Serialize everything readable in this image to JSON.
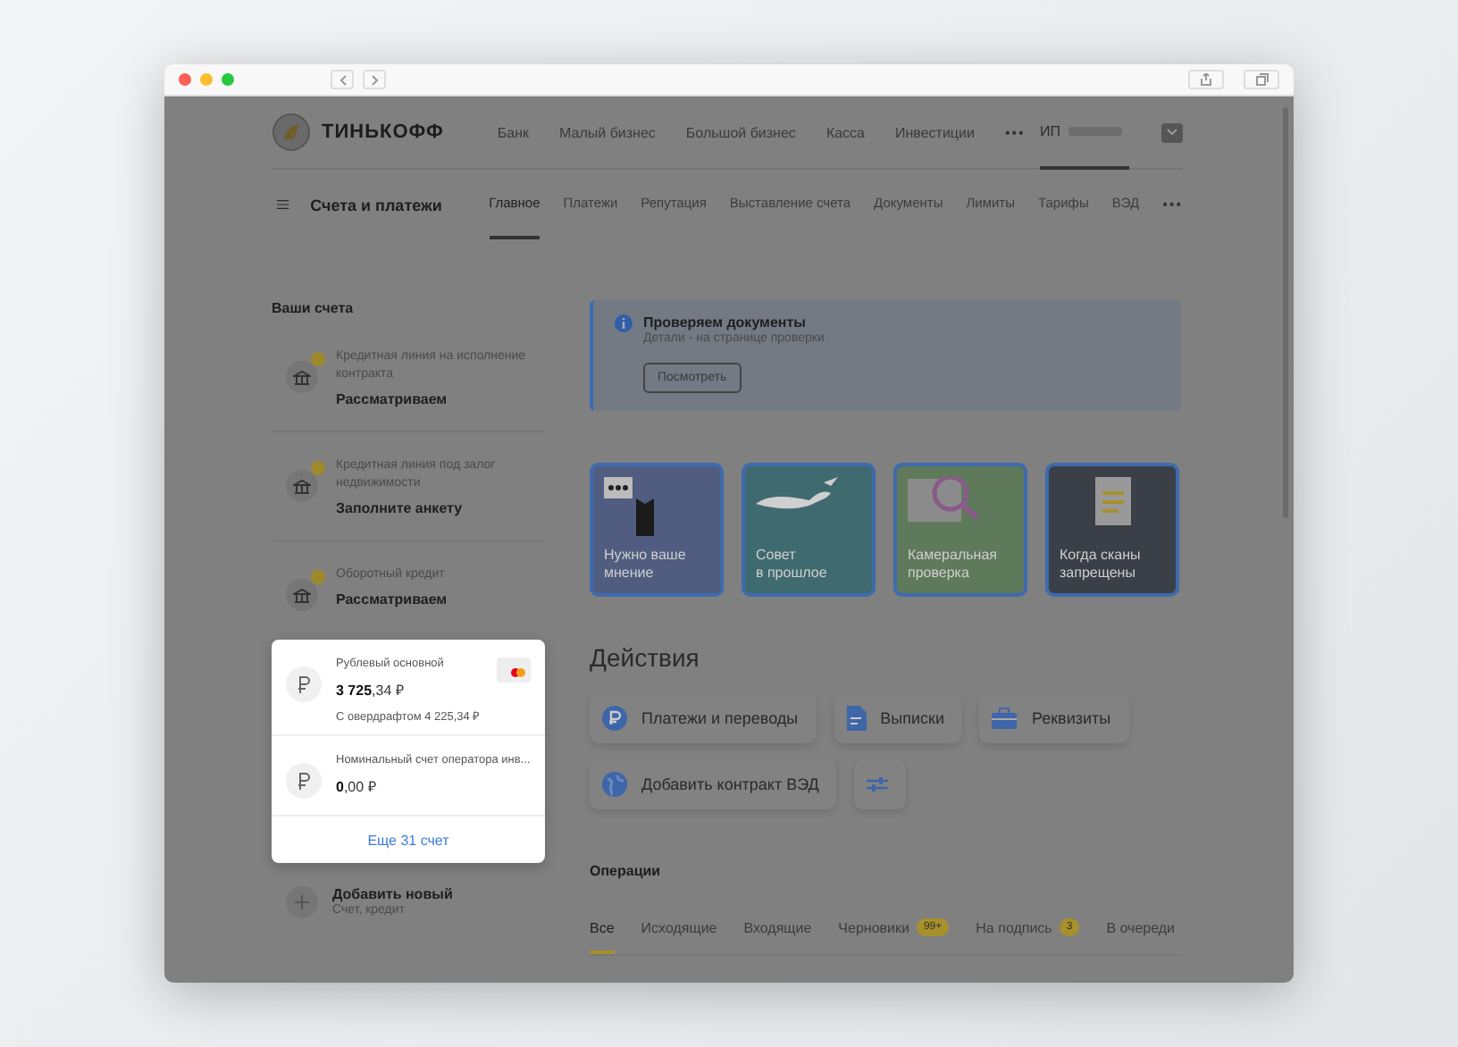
{
  "header": {
    "logo": "ТИНЬКОФФ",
    "nav": [
      "Банк",
      "Малый бизнес",
      "Большой бизнес",
      "Касса",
      "Инвестиции"
    ],
    "more": "•••",
    "account": "ИП"
  },
  "subnav": {
    "title": "Счета и платежи",
    "tabs": [
      {
        "label": "Главное",
        "selected": true
      },
      {
        "label": "Платежи",
        "selected": false
      },
      {
        "label": "Репутация",
        "selected": false
      },
      {
        "label": "Выставление счета",
        "selected": false
      },
      {
        "label": "Документы",
        "selected": false
      },
      {
        "label": "Лимиты",
        "selected": false
      },
      {
        "label": "Тарифы",
        "selected": false
      },
      {
        "label": "ВЭД",
        "selected": false
      }
    ],
    "more": "•••"
  },
  "accounts": {
    "heading": "Ваши счета",
    "credits": [
      {
        "title": "Кредитная линия на исполнение контракта",
        "status": "Рассматриваем"
      },
      {
        "title": "Кредитная линия под залог недвижимости",
        "status": "Заполните анкету"
      },
      {
        "title": "Оборотный кредит",
        "status": "Рассматриваем"
      }
    ],
    "highlighted": [
      {
        "name": "Рублевый основной",
        "amount": "**3 725**,34 ₽",
        "overdraft": "С овердрафтом 4 225,34 ₽",
        "card": true
      },
      {
        "name": "Номинальный счет оператора инв...",
        "amount": "**0**,00 ₽",
        "card": false
      }
    ],
    "more_link": "Еще 31 счет",
    "add": {
      "title": "Добавить новый",
      "subtitle": "Счет, кредит"
    }
  },
  "notice": {
    "title": "Проверяем документы",
    "text": "Детали - на странице проверки",
    "button": "Посмотреть"
  },
  "stories": [
    {
      "kind": "cat",
      "lines": [
        "Нужно ваше",
        "мнение"
      ]
    },
    {
      "kind": "dog",
      "lines": [
        "Совет",
        "в прошлое"
      ]
    },
    {
      "kind": "vat",
      "lines": [
        "Камеральная",
        "проверка"
      ]
    },
    {
      "kind": "doc",
      "lines": [
        "Когда сканы",
        "запрещены"
      ]
    }
  ],
  "actions": {
    "heading": "Действия",
    "buttons": [
      {
        "kind": "payments",
        "label": "Платежи и переводы"
      },
      {
        "kind": "statements",
        "label": "Выписки"
      },
      {
        "kind": "requisites",
        "label": "Реквизиты"
      },
      {
        "kind": "globe",
        "label": "Добавить контракт ВЭД"
      },
      {
        "kind": "filters"
      }
    ]
  },
  "operations": {
    "heading": "Операции",
    "tabs": [
      {
        "label": "Все",
        "selected": true
      },
      {
        "label": "Исходящие",
        "selected": false
      },
      {
        "label": "Входящие",
        "selected": false
      },
      {
        "label": "Черновики",
        "selected": false,
        "badge": "99+"
      },
      {
        "label": "На подпись",
        "selected": false,
        "badge": "3"
      },
      {
        "label": "В очереди",
        "selected": false
      }
    ]
  }
}
